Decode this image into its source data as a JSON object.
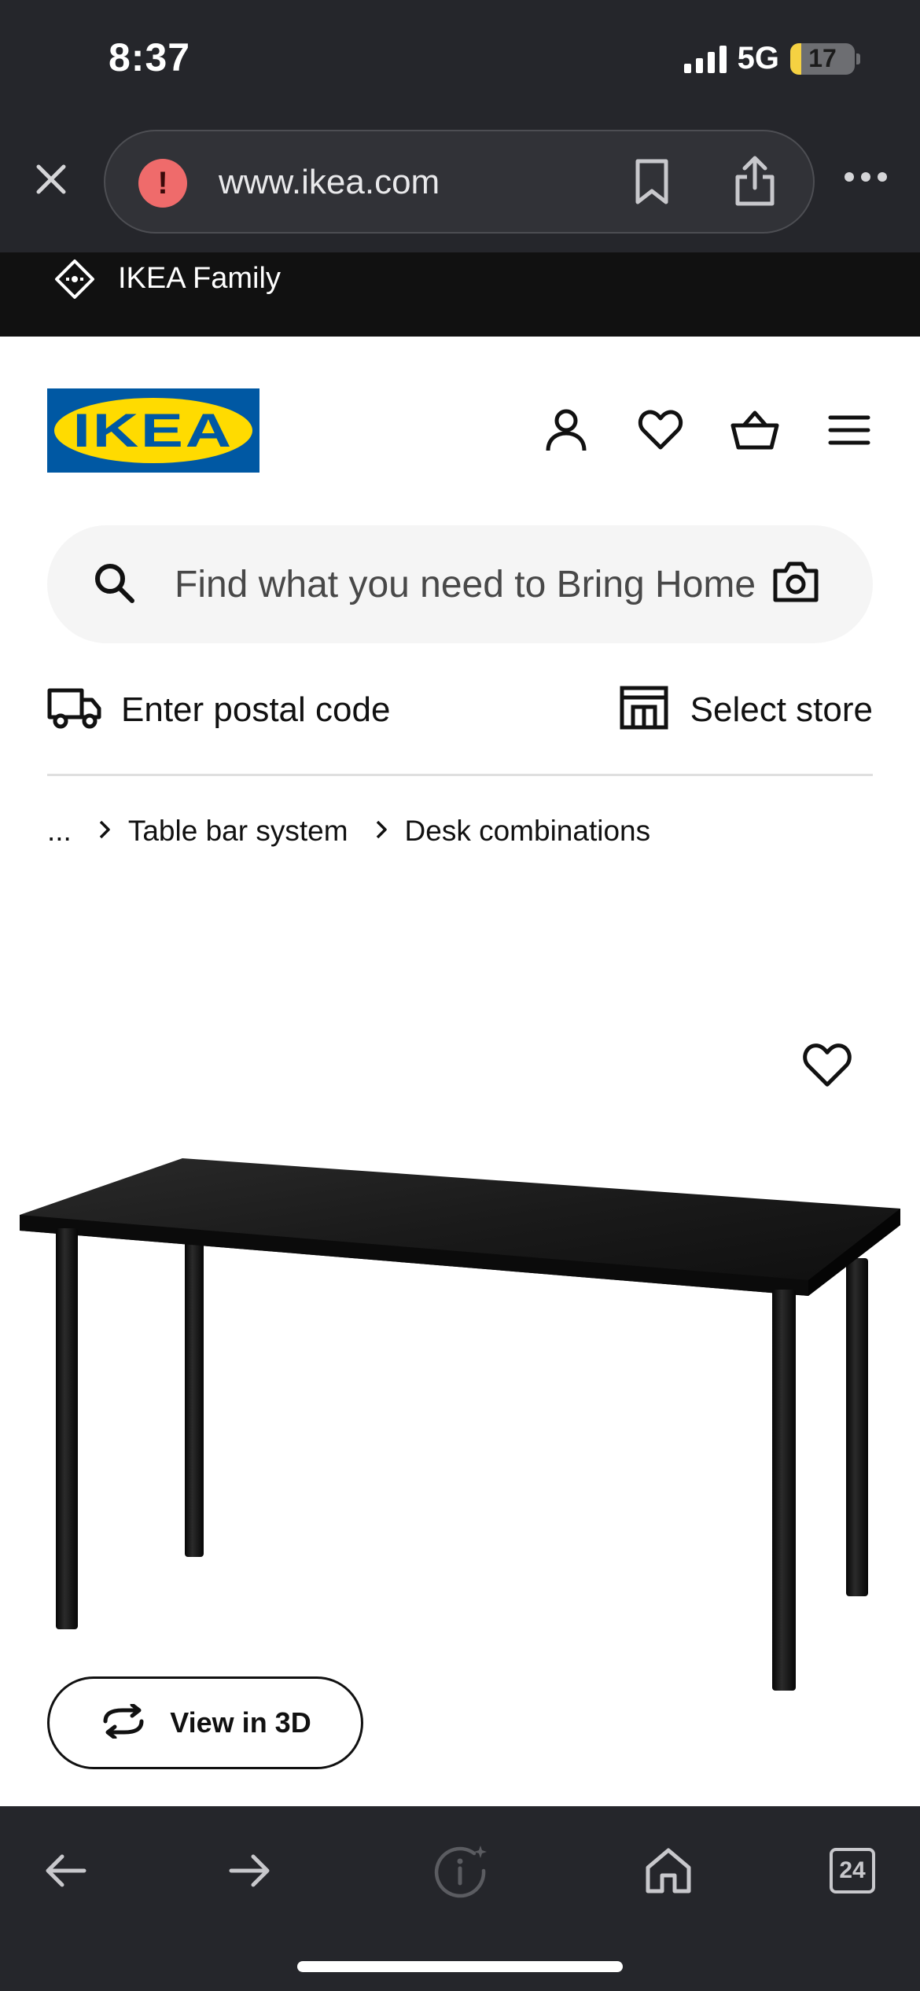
{
  "status_bar": {
    "time": "8:37",
    "network": "5G",
    "battery_level": "17",
    "battery_fraction": 0.17,
    "signal_icon": "cellular-signal-icon"
  },
  "browser": {
    "url": "www.ikea.com",
    "security_icon": "warning-icon",
    "close_icon": "close-icon",
    "bookmark_icon": "bookmark-icon",
    "share_icon": "share-icon",
    "more_icon": "more-dots-icon"
  },
  "promo_strip": {
    "label": "IKEA Family",
    "icon": "tag-icon"
  },
  "header": {
    "logo_text": "IKEA",
    "icons": [
      "account-icon",
      "heart-icon",
      "basket-icon",
      "menu-icon"
    ]
  },
  "search": {
    "placeholder": "Find what you need to Bring Home"
  },
  "delivery": {
    "postal_label": "Enter postal code",
    "store_label": "Select store"
  },
  "breadcrumb": {
    "ellipsis": "...",
    "items": [
      "Table bar system",
      "Desk combinations"
    ]
  },
  "product": {
    "view3d_label": "View in 3D"
  },
  "bottom_bar": {
    "tab_count": "24"
  },
  "colors": {
    "chrome_bg": "#25262b",
    "strip_bg": "#111111",
    "ikea_blue": "#0058a3",
    "ikea_yellow": "#ffdb00",
    "warning_red": "#ef6b6b",
    "battery_yellow": "#f5d142"
  }
}
